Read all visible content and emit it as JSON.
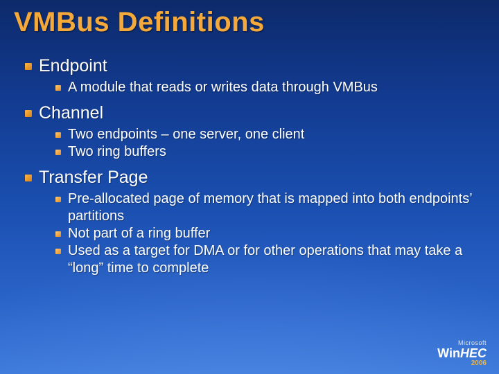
{
  "title": "VMBus Definitions",
  "items": [
    {
      "label": "Endpoint",
      "sub": [
        "A module that reads or writes data through VMBus"
      ]
    },
    {
      "label": "Channel",
      "sub": [
        "Two endpoints – one server, one client",
        "Two ring buffers"
      ]
    },
    {
      "label": "Transfer Page",
      "sub": [
        "Pre-allocated page of memory that is mapped into both endpoints’ partitions",
        "Not part of a ring buffer",
        "Used as a target for DMA or for other operations that may take a “long” time to complete"
      ]
    }
  ],
  "footer": {
    "brand_top": "Microsoft",
    "brand_main_a": "Win",
    "brand_main_b": "HEC",
    "year": "2006"
  }
}
